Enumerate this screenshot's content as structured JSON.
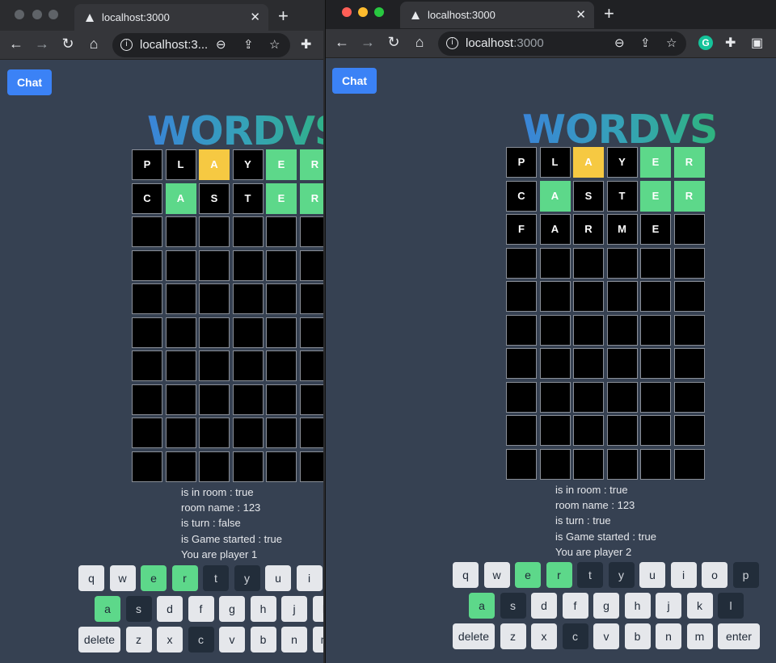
{
  "browser_left": {
    "tab_title": "localhost:3000",
    "url_host": "localhost:3...",
    "url_port": ""
  },
  "browser_right": {
    "tab_title": "localhost:3000",
    "url_host": "localhost",
    "url_port": ":3000"
  },
  "app": {
    "chat_label": "Chat",
    "logo": "WORDVS"
  },
  "left": {
    "board": [
      [
        "P",
        "L",
        "A",
        "Y",
        "E",
        "R"
      ],
      [
        "C",
        "A",
        "S",
        "T",
        "E",
        "R"
      ],
      [
        "",
        "",
        "",
        "",
        "",
        ""
      ],
      [
        "",
        "",
        "",
        "",
        "",
        ""
      ],
      [
        "",
        "",
        "",
        "",
        "",
        ""
      ],
      [
        "",
        "",
        "",
        "",
        "",
        ""
      ],
      [
        "",
        "",
        "",
        "",
        "",
        ""
      ],
      [
        "",
        "",
        "",
        "",
        "",
        ""
      ],
      [
        "",
        "",
        "",
        "",
        "",
        ""
      ],
      [
        "",
        "",
        "",
        "",
        "",
        ""
      ]
    ],
    "board_colors": [
      [
        "",
        "",
        "y",
        "",
        "g",
        "g"
      ],
      [
        "",
        "g",
        "",
        "",
        "g",
        "g"
      ]
    ],
    "status": [
      "is in room : true",
      "room name : 123",
      "is turn : false",
      "is Game started : true",
      "You are player 1"
    ]
  },
  "right": {
    "board": [
      [
        "P",
        "L",
        "A",
        "Y",
        "E",
        "R"
      ],
      [
        "C",
        "A",
        "S",
        "T",
        "E",
        "R"
      ],
      [
        "F",
        "A",
        "R",
        "M",
        "E",
        ""
      ],
      [
        "",
        "",
        "",
        "",
        "",
        ""
      ],
      [
        "",
        "",
        "",
        "",
        "",
        ""
      ],
      [
        "",
        "",
        "",
        "",
        "",
        ""
      ],
      [
        "",
        "",
        "",
        "",
        "",
        ""
      ],
      [
        "",
        "",
        "",
        "",
        "",
        ""
      ],
      [
        "",
        "",
        "",
        "",
        "",
        ""
      ],
      [
        "",
        "",
        "",
        "",
        "",
        ""
      ]
    ],
    "board_colors": [
      [
        "",
        "",
        "y",
        "",
        "g",
        "g"
      ],
      [
        "",
        "g",
        "",
        "",
        "g",
        "g"
      ]
    ],
    "status": [
      "is in room : true",
      "room name : 123",
      "is turn : true",
      "is Game started : true",
      "You are player 2"
    ]
  },
  "keyboard": {
    "row1": [
      "q",
      "w",
      "e",
      "r",
      "t",
      "y",
      "u",
      "i",
      "o",
      "p"
    ],
    "row2": [
      "a",
      "s",
      "d",
      "f",
      "g",
      "h",
      "j",
      "k",
      "l"
    ],
    "row3": [
      "delete",
      "z",
      "x",
      "c",
      "v",
      "b",
      "n",
      "m",
      "enter"
    ],
    "green": [
      "e",
      "r",
      "a"
    ],
    "dark": [
      "t",
      "y",
      "p",
      "s",
      "l",
      "c"
    ]
  },
  "colors": {
    "green": "#5dd88a",
    "yellow": "#f6c942",
    "page_bg": "#364152",
    "chat_button": "#3b82f6"
  }
}
